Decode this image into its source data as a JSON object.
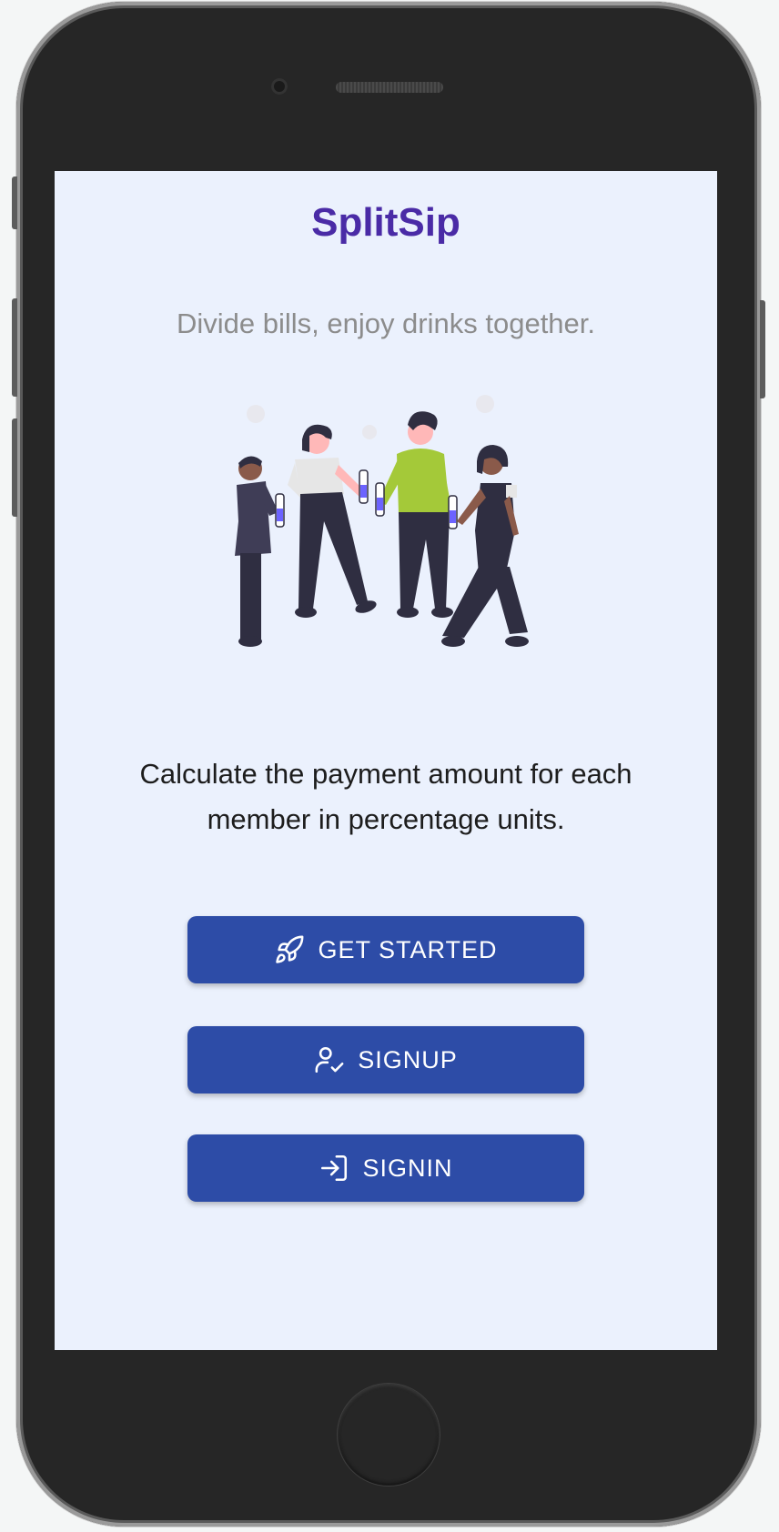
{
  "app": {
    "title": "SplitSip",
    "subtitle": "Divide bills, enjoy drinks together.",
    "description": "Calculate the payment amount for each member in percentage units."
  },
  "buttons": {
    "get_started": {
      "label": "GET STARTED",
      "icon": "rocket-icon"
    },
    "signup": {
      "label": "SIGNUP",
      "icon": "user-check-icon"
    },
    "signin": {
      "label": "SIGNIN",
      "icon": "login-icon"
    }
  },
  "colors": {
    "brand": "#4a2ba6",
    "button": "#2d4ca7",
    "screen_bg": "#ebf1fd",
    "subtitle": "#8c8c8c",
    "accent_green": "#a4c939",
    "bottle_liquid": "#6c63ff"
  }
}
